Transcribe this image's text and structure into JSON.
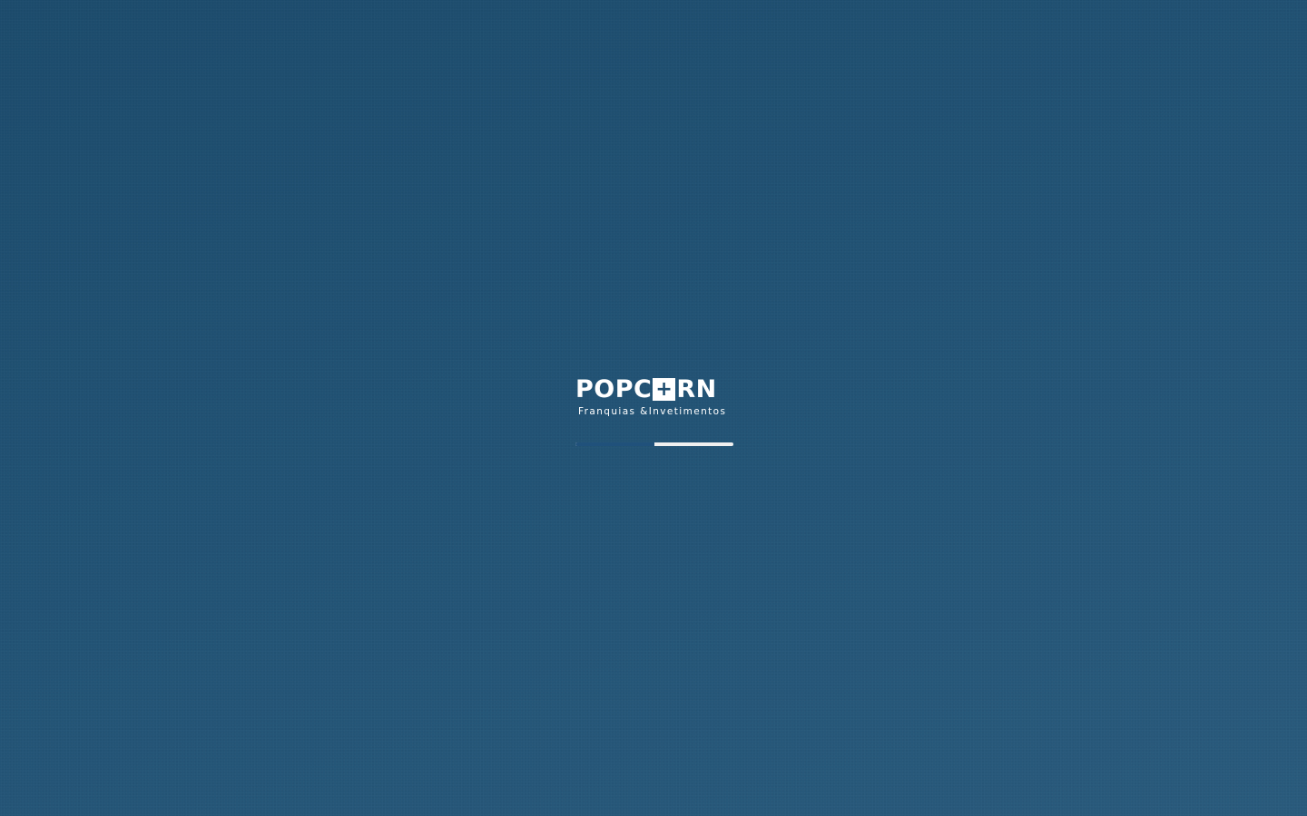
{
  "brand": {
    "name_prefix": "POPC",
    "name_icon": "+",
    "name_suffix": "RN",
    "tagline": "Franquias &Invetimentos",
    "logo_icon": "plus-square-icon"
  },
  "loader": {
    "progress": 0.5
  },
  "colors": {
    "background": "#215274",
    "logo_text": "#ffffff",
    "progress_track": "#f0f0f0",
    "progress_fill": "#20517b"
  }
}
